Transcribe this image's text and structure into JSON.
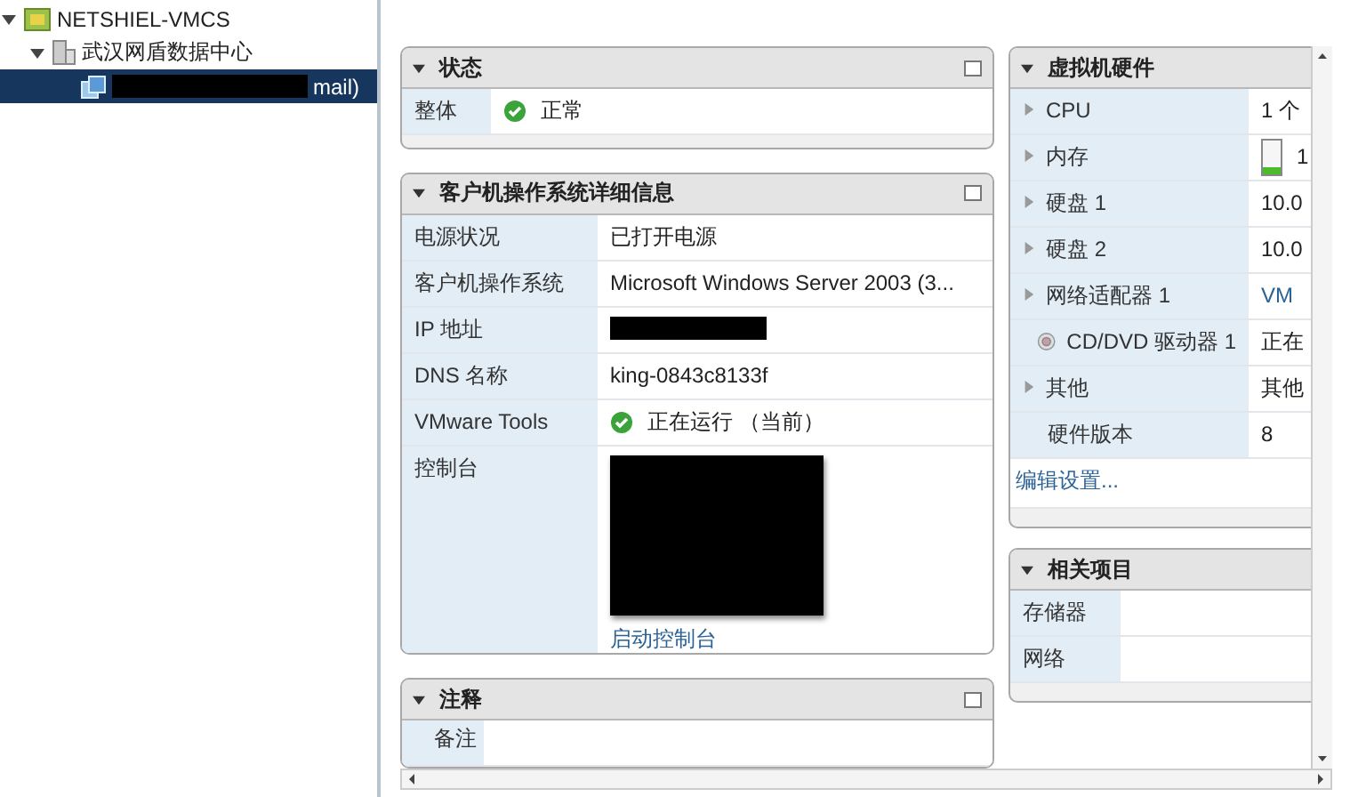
{
  "tree": [
    {
      "label": "NETSHIEL-VMCS",
      "kind": "vcenter",
      "expanded": true,
      "selected": false,
      "children": [
        {
          "label": "武汉网盾数据中心",
          "kind": "datacenter",
          "expanded": true,
          "selected": false,
          "children": [
            {
              "label": "mail)",
              "kind": "vm",
              "redacted": true,
              "selected": true
            }
          ]
        }
      ]
    }
  ],
  "status_panel": {
    "title": "状态",
    "expanded": true,
    "rows": [
      {
        "label": "整体",
        "value": "正常",
        "ok": true
      }
    ]
  },
  "guest_panel": {
    "title": "客户机操作系统详细信息",
    "expanded": true,
    "rows": [
      {
        "kind": "text",
        "label": "电源状况",
        "value": "已打开电源"
      },
      {
        "kind": "text",
        "label": "客户机操作系统",
        "value": "Microsoft Windows Server 2003 (3..."
      },
      {
        "kind": "redacted",
        "label": "IP 地址"
      },
      {
        "kind": "text",
        "label": "DNS 名称",
        "value": "king-0843c8133f"
      },
      {
        "kind": "status",
        "label": "VMware Tools",
        "value": "正在运行 （当前）",
        "ok": true
      },
      {
        "kind": "console",
        "label": "控制台",
        "link": "启动控制台"
      }
    ]
  },
  "notes_panel": {
    "title": "注释",
    "expanded": true,
    "rows": [
      {
        "label": "备注"
      }
    ]
  },
  "hardware_panel": {
    "title": "虚拟机硬件",
    "expanded": true,
    "rows": [
      {
        "kind": "expandable",
        "label": "CPU",
        "value": "1 个"
      },
      {
        "kind": "memory",
        "label": "内存",
        "value": "1",
        "level": 0.2
      },
      {
        "kind": "expandable",
        "label": "硬盘 1",
        "value": "10.0"
      },
      {
        "kind": "expandable",
        "label": "硬盘 2",
        "value": "10.0"
      },
      {
        "kind": "link",
        "label": "网络适配器 1",
        "value": "VM"
      },
      {
        "kind": "disc",
        "label": "CD/DVD 驱动器 1",
        "value": "正在"
      },
      {
        "kind": "expandable",
        "label": "其他",
        "value": "其他"
      },
      {
        "kind": "plain",
        "label": "硬件版本",
        "value": "8"
      }
    ],
    "link": "编辑设置..."
  },
  "related_panel": {
    "title": "相关项目",
    "expanded": true,
    "rows": [
      {
        "label": "存储器"
      },
      {
        "label": "网络"
      }
    ]
  }
}
